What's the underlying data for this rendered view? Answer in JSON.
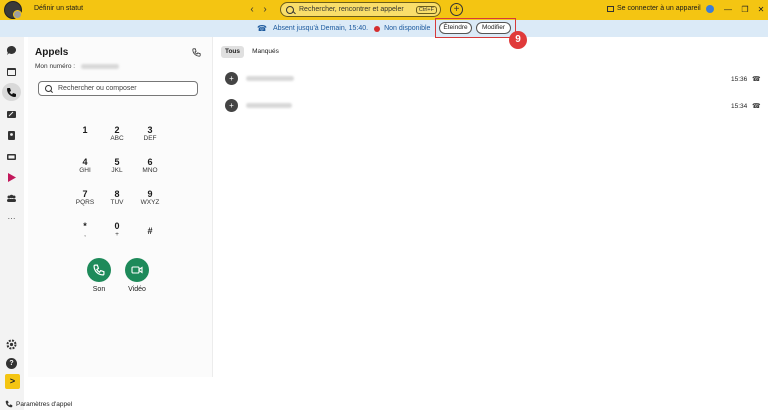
{
  "titlebar": {
    "status_label": "Définir un statut",
    "back_arrow": "‹",
    "forward_arrow": "›",
    "search_placeholder": "Rechercher, rencontrer et appeler",
    "search_shortcut": "Ctrl+F",
    "add_symbol": "+",
    "connect_label": "Se connecter à un appareil",
    "minimize": "—",
    "restore": "❐",
    "close": "✕"
  },
  "banner": {
    "status_text": "Absent jusqu'à Demain, 15:40.",
    "availability": "Non disponible",
    "turn_off_label": "Éteindre",
    "edit_label": "Modifier",
    "step_number": "9",
    "status_color": "#d42e2e"
  },
  "rail": {
    "icons": [
      "chat-icon",
      "calendar-icon",
      "phone-icon",
      "voicemail-icon",
      "contacts-icon",
      "tv-icon",
      "play-icon",
      "teams-icon",
      "more-icon",
      "settings-icon",
      "help-icon",
      "expand-icon"
    ],
    "more_glyph": "···",
    "help_glyph": "?",
    "expand_glyph": ">"
  },
  "calls": {
    "title": "Appels",
    "my_number_label": "Mon numéro :",
    "search_placeholder": "Rechercher ou composer",
    "keys": [
      {
        "digit": "1",
        "letters": ""
      },
      {
        "digit": "2",
        "letters": "ABC"
      },
      {
        "digit": "3",
        "letters": "DEF"
      },
      {
        "digit": "4",
        "letters": "GHI"
      },
      {
        "digit": "5",
        "letters": "JKL"
      },
      {
        "digit": "6",
        "letters": "MNO"
      },
      {
        "digit": "7",
        "letters": "PQRS"
      },
      {
        "digit": "8",
        "letters": "TUV"
      },
      {
        "digit": "9",
        "letters": "WXYZ"
      },
      {
        "digit": "*",
        "letters": ","
      },
      {
        "digit": "0",
        "letters": "+"
      },
      {
        "digit": "#",
        "letters": ""
      }
    ],
    "audio_label": "Son",
    "video_label": "Vidéo",
    "accent_color": "#1e8a5a"
  },
  "footer": {
    "settings_label": "Paramètres d'appel"
  },
  "history": {
    "tabs": [
      "Tous",
      "Manqués"
    ],
    "rows": [
      {
        "avatar": "+",
        "time": "15:36"
      },
      {
        "avatar": "+",
        "time": "15:34"
      }
    ]
  }
}
